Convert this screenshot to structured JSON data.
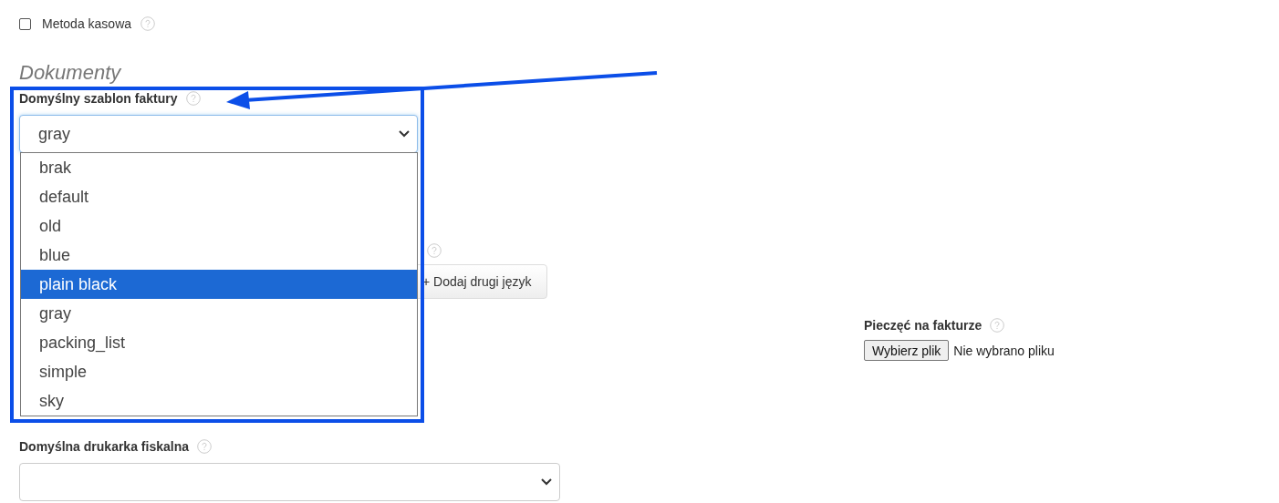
{
  "cash_method": {
    "label": "Metoda kasowa",
    "checked": false
  },
  "section_title": "Dokumenty",
  "invoice_template": {
    "label": "Domyślny szablon faktury",
    "value": "gray",
    "open": true,
    "options": [
      {
        "label": "brak",
        "highlighted": false
      },
      {
        "label": "default",
        "highlighted": false
      },
      {
        "label": "old",
        "highlighted": false
      },
      {
        "label": "blue",
        "highlighted": false
      },
      {
        "label": "plain black",
        "highlighted": true
      },
      {
        "label": "gray",
        "highlighted": false
      },
      {
        "label": "packing_list",
        "highlighted": false
      },
      {
        "label": "simple",
        "highlighted": false
      },
      {
        "label": "sky",
        "highlighted": false
      }
    ]
  },
  "second_language_button": "+ Dodaj drugi język",
  "stamp": {
    "label": "Pieczęć na fakturze",
    "button": "Wybierz plik",
    "status": "Nie wybrano pliku"
  },
  "fiscal_printer": {
    "label": "Domyślna drukarka fiskalna"
  }
}
